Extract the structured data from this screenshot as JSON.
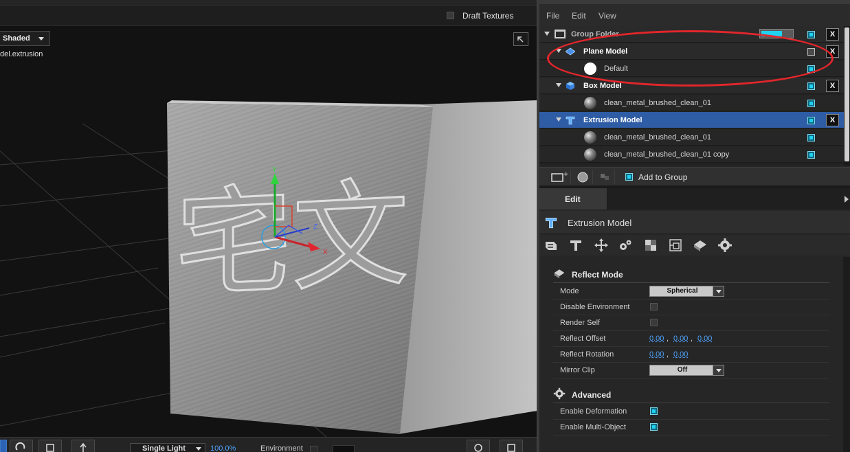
{
  "viewport": {
    "draft_textures_label": "Draft Textures",
    "shade_mode": "Shaded",
    "model_path": "del.extrusion",
    "axis_labels": {
      "y": "Y",
      "z": "Z",
      "x": "X"
    },
    "embossed_text": "宅文",
    "bottom": {
      "light_mode": "Single Light",
      "zoom": "100.0%",
      "environment_label": "Environment"
    }
  },
  "scene": {
    "menu": [
      "File",
      "Edit",
      "View"
    ],
    "tree": [
      {
        "label": "Group Folder"
      },
      {
        "label": "Plane Model"
      },
      {
        "label": "Default"
      },
      {
        "label": "Box Model"
      },
      {
        "label": "clean_metal_brushed_clean_01"
      },
      {
        "label": "Extrusion Model"
      },
      {
        "label": "clean_metal_brushed_clean_01"
      },
      {
        "label": "clean_metal_brushed_clean_01 copy"
      }
    ],
    "close_label": "X",
    "add_to_group": "Add to Group"
  },
  "edit": {
    "tab": "Edit",
    "title": "Extrusion Model",
    "reflect_section": "Reflect Mode",
    "advanced_section": "Advanced",
    "props": {
      "mode": {
        "label": "Mode",
        "value": "Spherical"
      },
      "disable_env": {
        "label": "Disable Environment"
      },
      "render_self": {
        "label": "Render Self"
      },
      "reflect_offset": {
        "label": "Reflect Offset",
        "x": "0.00",
        "y": "0.00",
        "z": "0.00"
      },
      "reflect_rotation": {
        "label": "Reflect Rotation",
        "x": "0.00",
        "y": "0.00"
      },
      "mirror_clip": {
        "label": "Mirror Clip",
        "value": "Off"
      },
      "enable_deformation": {
        "label": "Enable Deformation"
      },
      "enable_multi_object": {
        "label": "Enable Multi-Object"
      }
    },
    "comma": ","
  },
  "colors": {
    "accent_cyan": "#1fd2f0",
    "selection_blue": "#2f5da5",
    "value_blue": "#4fa3ff",
    "annotation_red": "#e2262b"
  }
}
